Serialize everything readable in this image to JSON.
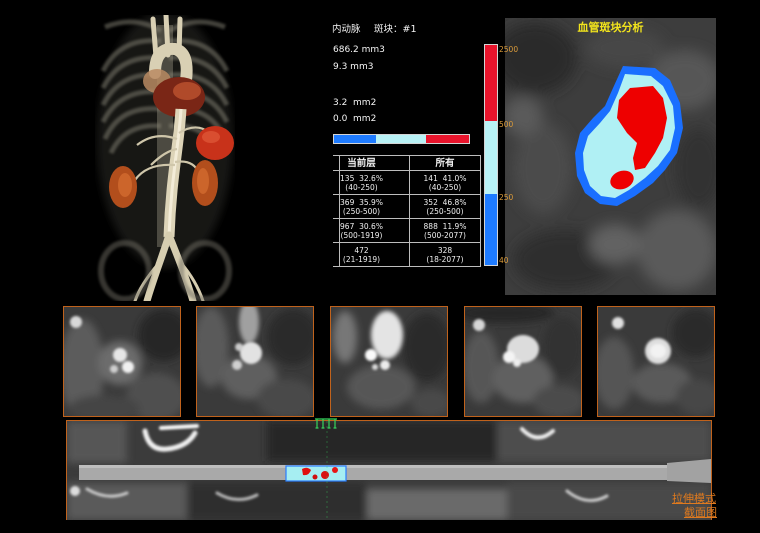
{
  "analysis_view": {
    "title": "血管斑块分析"
  },
  "plaque_info": {
    "vessel_name": "内动脉",
    "plaque_label": "斑块：#1",
    "volume_1": "686.2 mm3",
    "volume_2": "9.3 mm3",
    "area_1": "3.2  mm2",
    "area_2": "0.0  mm2"
  },
  "composition_table": {
    "header": {
      "current": "当前层",
      "all": "所有"
    },
    "rows": [
      {
        "current_value": "135  32.6%",
        "current_range": "(40-250)",
        "all_value": "141  41.0%",
        "all_range": "(40-250)"
      },
      {
        "current_value": "369  35.9%",
        "current_range": "(250-500)",
        "all_value": "352  46.8%",
        "all_range": "(250-500)"
      },
      {
        "current_value": "967  30.6%",
        "current_range": "(500-1919)",
        "all_value": "888  11.9%",
        "all_range": "(500-2077)"
      },
      {
        "current_value": "472",
        "current_range": "(21-1919)",
        "all_value": "328",
        "all_range": "(18-2077)"
      }
    ]
  },
  "hu_scale": {
    "max": "2500",
    "upper": "500",
    "lower": "250",
    "min": "40"
  },
  "cpr_view": {
    "mode_link": "拉伸模式",
    "section_link": "截面图"
  },
  "colors": {
    "panel_border": "#c0621c",
    "view_title": "#f2e41c",
    "scale_label": "#d99a3a",
    "scale_high": "#e8142c",
    "scale_mid": "#b8f2f6",
    "scale_low": "#1e7bff",
    "marker": "#36d65c",
    "link": "#e07a1e"
  }
}
